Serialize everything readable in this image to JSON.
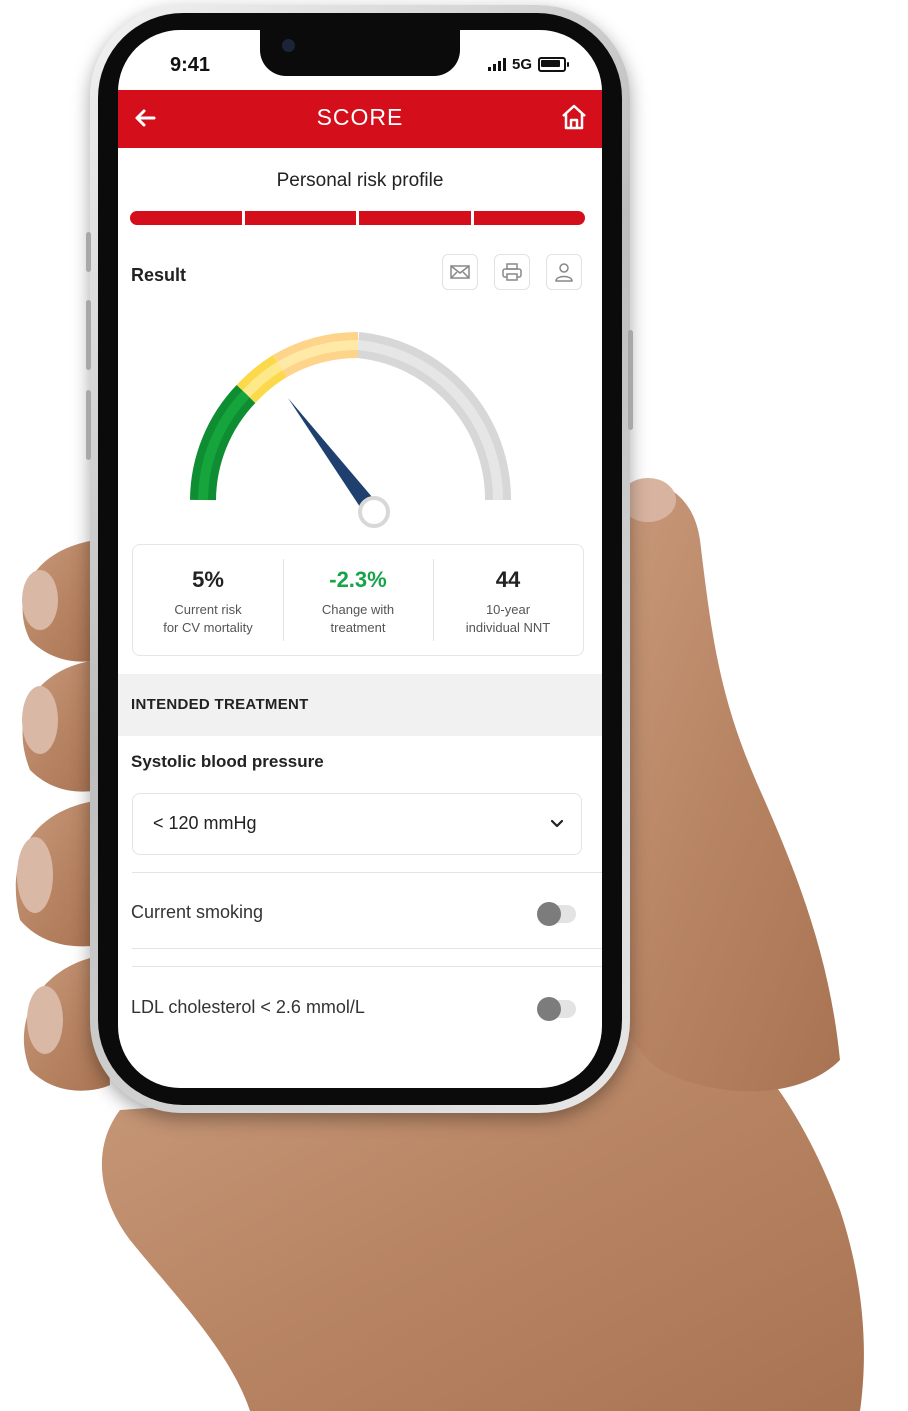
{
  "status_bar": {
    "time": "9:41",
    "network": "5G"
  },
  "app_bar": {
    "title": "SCORE",
    "back_icon": "arrow-left-icon",
    "home_icon": "home-icon"
  },
  "profile": {
    "title": "Personal risk profile",
    "progress_steps": 4,
    "steps_completed": 4
  },
  "result": {
    "label": "Result",
    "actions": [
      "mail-icon",
      "print-icon",
      "user-icon"
    ]
  },
  "gauge": {
    "risk_percent": 5,
    "zones": [
      "green",
      "yellow",
      "light-yellow",
      "grey"
    ]
  },
  "stats": [
    {
      "value": "5%",
      "label": "Current risk\nfor CV mortality"
    },
    {
      "value": "-2.3%",
      "label": "Change with\ntreatment"
    },
    {
      "value": "44",
      "label": "10-year\nindividual NNT"
    }
  ],
  "treatment": {
    "header": "INTENDED TREATMENT",
    "sbp_label": "Systolic blood pressure",
    "sbp_value": "< 120 mmHg",
    "toggles": [
      {
        "label": "Current smoking",
        "on": false
      },
      {
        "label": "LDL cholesterol < 2.6 mmol/L",
        "on": false
      }
    ]
  },
  "colors": {
    "brand_red": "#d40f1b",
    "positive_green": "#16a34a",
    "gauge_needle": "#1f3f6e"
  }
}
